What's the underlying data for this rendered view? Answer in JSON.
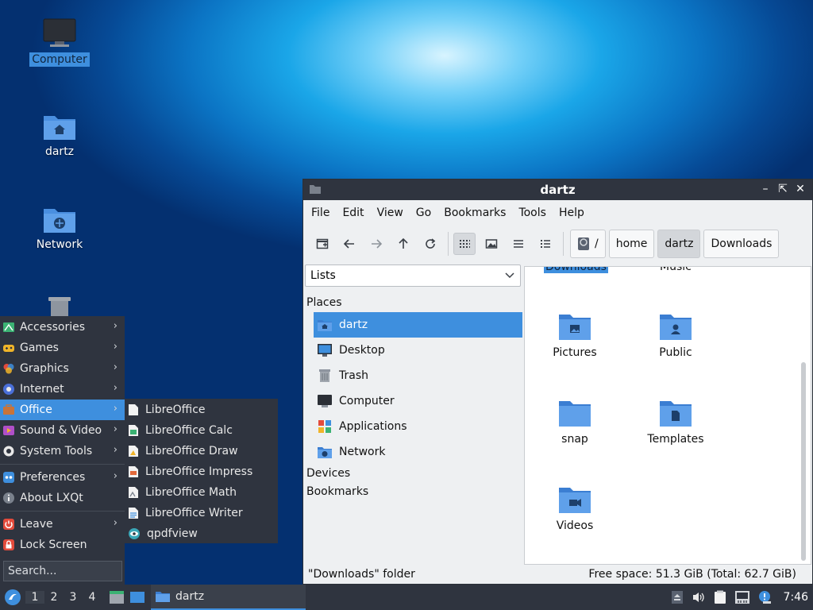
{
  "desktop": {
    "icons": [
      {
        "label": "Computer"
      },
      {
        "label": "dartz"
      },
      {
        "label": "Network"
      }
    ]
  },
  "window": {
    "title": "dartz",
    "menu": [
      "File",
      "Edit",
      "View",
      "Go",
      "Bookmarks",
      "Tools",
      "Help"
    ],
    "breadcrumbs": [
      "/",
      "home",
      "dartz",
      "Downloads"
    ],
    "side_selector": "Lists",
    "sections": {
      "places": "Places",
      "devices": "Devices",
      "bookmarks": "Bookmarks"
    },
    "places": [
      "dartz",
      "Desktop",
      "Trash",
      "Computer",
      "Applications",
      "Network"
    ],
    "files_partial": [
      "Downloads",
      "Music"
    ],
    "files": [
      "Pictures",
      "Public",
      "snap",
      "Templates",
      "Videos"
    ],
    "status_left": "\"Downloads\" folder",
    "status_right": "Free space: 51.3 GiB (Total: 62.7 GiB)"
  },
  "start_menu": {
    "categories": [
      "Accessories",
      "Games",
      "Graphics",
      "Internet",
      "Office",
      "Sound & Video",
      "System Tools"
    ],
    "settings": [
      "Preferences",
      "About LXQt"
    ],
    "session": [
      "Leave",
      "Lock Screen"
    ],
    "search_placeholder": "Search...",
    "selected": "Office"
  },
  "office_submenu": [
    "LibreOffice",
    "LibreOffice Calc",
    "LibreOffice Draw",
    "LibreOffice Impress",
    "LibreOffice Math",
    "LibreOffice Writer",
    "qpdfview"
  ],
  "panel": {
    "workspaces": [
      "1",
      "2",
      "3",
      "4"
    ],
    "task_title": "dartz",
    "clock": "7:46"
  },
  "colors": {
    "accent": "#3e8fde",
    "panel": "#2f343f",
    "folder": "#4a8fe0"
  }
}
